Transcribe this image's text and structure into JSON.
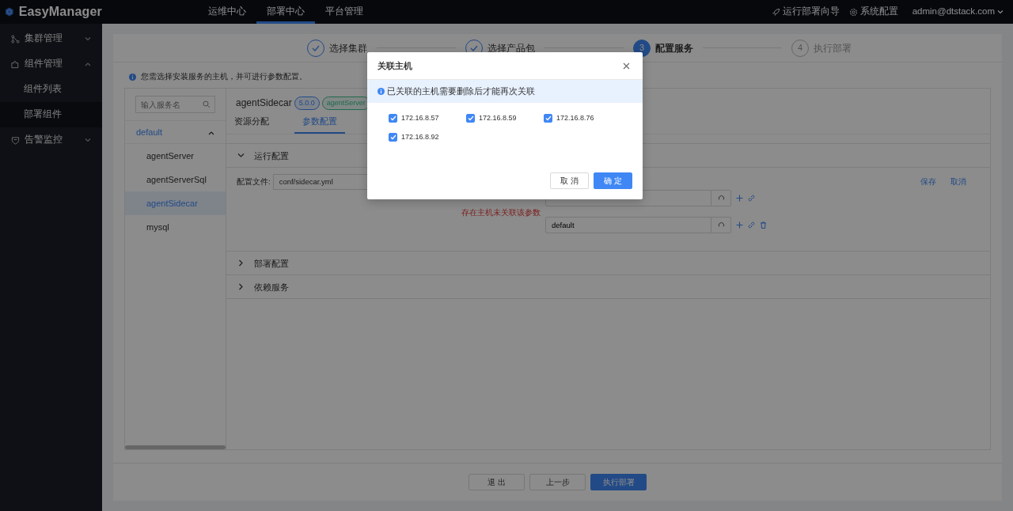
{
  "header": {
    "logo": "EasyManager",
    "nav": [
      {
        "label": "运维中心",
        "selected": false
      },
      {
        "label": "部署中心",
        "selected": true
      },
      {
        "label": "平台管理",
        "selected": false
      }
    ],
    "actions": [
      {
        "label": "运行部署向导"
      },
      {
        "label": "系统配置"
      }
    ],
    "user": "admin@dtstack.com"
  },
  "sidebar": {
    "items": [
      {
        "label": "集群管理",
        "expanded": false
      },
      {
        "label": "组件管理",
        "expanded": true,
        "children": [
          {
            "label": "组件列表",
            "selected": false
          },
          {
            "label": "部署组件",
            "selected": true
          }
        ]
      },
      {
        "label": "告警监控",
        "expanded": false
      }
    ]
  },
  "steps": [
    {
      "label": "选择集群",
      "completed": true,
      "active": false
    },
    {
      "label": "选择产品包",
      "completed": true,
      "active": false
    },
    {
      "number": "3",
      "label": "配置服务",
      "completed": false,
      "active": true
    },
    {
      "number": "4",
      "label": "执行部署",
      "completed": false,
      "active": false
    }
  ],
  "notice": "您需选择安装服务的主机，并可进行参数配置。",
  "services": {
    "search_placeholder": "输入服务名",
    "group": {
      "label": "default",
      "expanded": true
    },
    "items": [
      {
        "label": "agentServer",
        "selected": false
      },
      {
        "label": "agentServerSql",
        "selected": false
      },
      {
        "label": "agentSidecar",
        "selected": true
      },
      {
        "label": "mysql",
        "selected": false
      }
    ]
  },
  "detail": {
    "title": "agentSidecar",
    "version": "5.0.0",
    "tag": "agentServer",
    "tabs": [
      {
        "label": "资源分配",
        "selected": false
      },
      {
        "label": "参数配置",
        "selected": true
      }
    ],
    "sections": [
      {
        "title": "运行配置",
        "expanded": true
      },
      {
        "title": "部署配置",
        "expanded": false
      },
      {
        "title": "依赖服务",
        "expanded": false
      }
    ],
    "config_label": "配置文件:",
    "config_file": "conf/sidecar.yml",
    "config_actions": [
      "保存",
      "取消"
    ],
    "param_warning": "存在主机未关联该参数",
    "params": [
      {
        "deletable": false
      },
      {
        "value": "default",
        "deletable": true
      }
    ]
  },
  "footer_buttons": [
    {
      "label": "退 出",
      "kind": "default"
    },
    {
      "label": "上一步",
      "kind": "default"
    },
    {
      "label": "执行部署",
      "kind": "primary"
    }
  ],
  "modal": {
    "title": "关联主机",
    "alert": "已关联的主机需要删除后才能再次关联",
    "hosts": [
      {
        "label": "172.16.8.57",
        "checked": true
      },
      {
        "label": "172.16.8.59",
        "checked": true
      },
      {
        "label": "172.16.8.76",
        "checked": true
      },
      {
        "label": "172.16.8.92",
        "checked": true
      }
    ],
    "buttons": [
      {
        "label": "取 消",
        "kind": "default"
      },
      {
        "label": "确 定",
        "kind": "primary"
      }
    ]
  }
}
